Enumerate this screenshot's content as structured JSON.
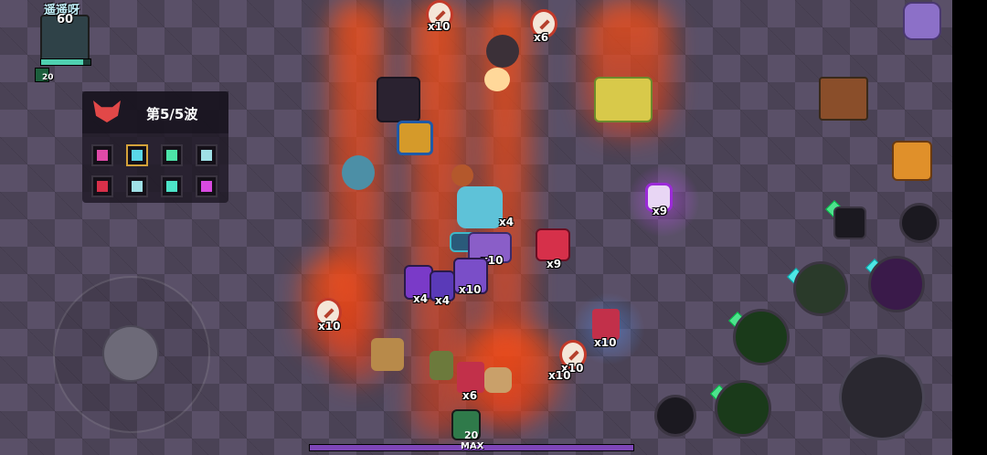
{
  "player": {
    "name": "遥遥呀",
    "level": "60",
    "xp_fraction": 0.85,
    "small_badge_number": "20"
  },
  "wave": {
    "label": "第5/5波",
    "icon": "demon-head-icon",
    "buffs": [
      "crosshair-icon",
      "shield-buff-icon",
      "heart-icon",
      "armor-icon",
      "berserk-icon",
      "armor-icon",
      "sword-icon",
      "flame-icon"
    ]
  },
  "drops": [
    {
      "id": "coin-top-1",
      "count": "x10"
    },
    {
      "id": "coin-top-2",
      "count": "x6"
    },
    {
      "id": "potion-purple",
      "count": "x9"
    },
    {
      "id": "stack-center",
      "count": "x10"
    },
    {
      "id": "dagger-card",
      "count": "x9"
    },
    {
      "id": "bottle-red",
      "count": "x4"
    },
    {
      "id": "bottle-blue",
      "count": "x4"
    },
    {
      "id": "wand-card",
      "count": "x10"
    },
    {
      "id": "coin-left",
      "count": "x10"
    },
    {
      "id": "crystal-right",
      "count": "x10"
    },
    {
      "id": "coin-right-a",
      "count": "x10"
    },
    {
      "id": "coin-right-b",
      "count": "x10"
    },
    {
      "id": "crystal-bottom",
      "count": "x6"
    },
    {
      "id": "stack-near-player",
      "count": "x4"
    }
  ],
  "bottom": {
    "level_badge": "20",
    "max_label": "MAX"
  },
  "icons": {
    "menu": "menu-icon",
    "exit": "exit-door-icon",
    "chest": "treasure-chest-icon",
    "weapon": "dagger-weapon-icon",
    "attack": "grab-hand-icon",
    "potion": "health-potion-icon"
  },
  "colors": {
    "fire": "#ff5a1e",
    "floor": "#5a5068",
    "accent_green": "#4de38d"
  }
}
